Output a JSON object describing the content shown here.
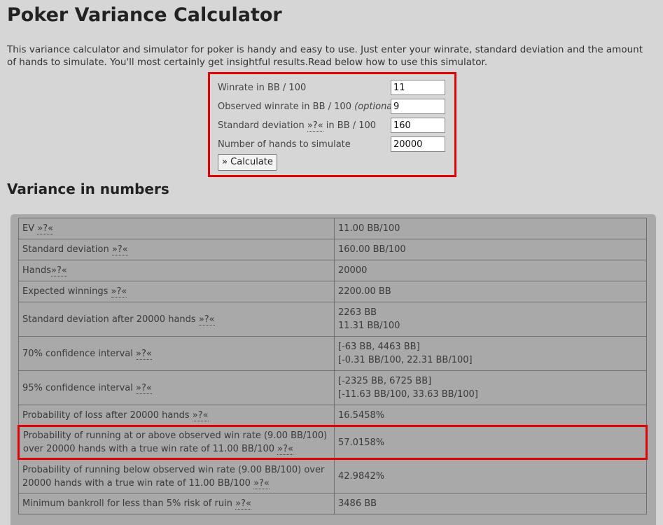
{
  "page_title": "Poker Variance Calculator",
  "intro": "This variance calculator and simulator for poker is handy and easy to use. Just enter your winrate, standard deviation and the amount of hands to simulate. You'll most certainly get insightful results.Read below how to use this simulator.",
  "form": {
    "winrate_label": "Winrate in BB / 100",
    "winrate_value": "11",
    "observed_label": "Observed winrate in BB / 100",
    "observed_optional": "(optional)",
    "observed_value": "9",
    "stddev_label_pre": "Standard deviation",
    "stddev_help": "»?«",
    "stddev_label_post": "in BB / 100",
    "stddev_value": "160",
    "hands_label": "Number of hands to simulate",
    "hands_value": "20000",
    "calculate_label": "» Calculate"
  },
  "results_heading": "Variance in numbers",
  "help_marker": "»?«",
  "rows": [
    {
      "label": "EV",
      "value1": "11.00 BB/100",
      "value2": ""
    },
    {
      "label": "Standard deviation",
      "value1": "160.00 BB/100",
      "value2": ""
    },
    {
      "label": "Hands",
      "value1": "20000",
      "value2": ""
    },
    {
      "label": "Expected winnings",
      "value1": "2200.00 BB",
      "value2": ""
    },
    {
      "label": "Standard deviation after 20000 hands",
      "value1": "2263 BB",
      "value2": "11.31 BB/100"
    },
    {
      "label": "70% confidence interval",
      "value1": "[-63 BB, 4463 BB]",
      "value2": "[-0.31 BB/100, 22.31 BB/100]"
    },
    {
      "label": "95% confidence interval",
      "value1": "[-2325 BB, 6725 BB]",
      "value2": "[-11.63 BB/100, 33.63 BB/100]"
    },
    {
      "label": "Probability of loss after 20000 hands",
      "value1": "16.5458%",
      "value2": ""
    },
    {
      "label_line1": "Probability of running at or above observed win rate (9.00 BB/100)",
      "label_line2": "over 20000 hands with a true win rate of 11.00 BB/100",
      "value1": "57.0158%",
      "value2": ""
    },
    {
      "label_line1": "Probability of running below observed win rate (9.00 BB/100) over",
      "label_line2": "20000 hands with a true win rate of 11.00 BB/100",
      "value1": "42.9842%",
      "value2": ""
    },
    {
      "label": "Minimum bankroll for less than 5% risk of ruin",
      "value1": "3486 BB",
      "value2": ""
    }
  ],
  "colors": {
    "background": "#d6d6d6",
    "highlight_border": "#e00000",
    "table_background": "#a9a9a9"
  }
}
